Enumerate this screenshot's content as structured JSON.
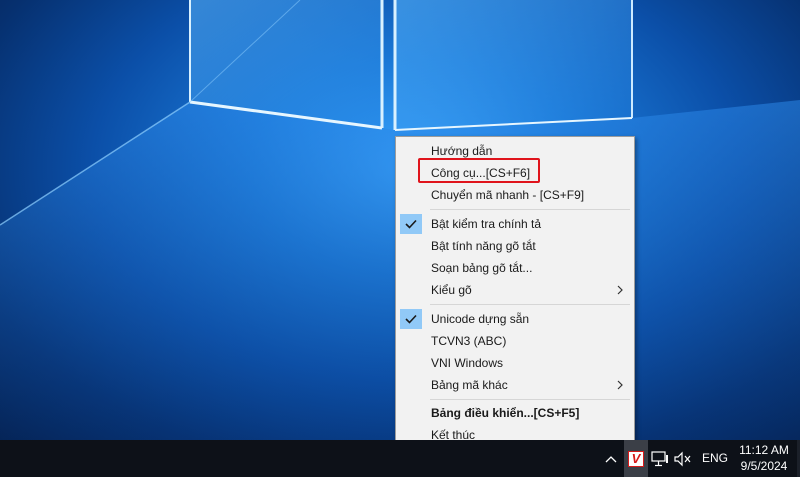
{
  "colors": {
    "menu_background": "#f2f2f2",
    "check_highlight": "#91c9f7",
    "annotation_red": "#e0141c",
    "taskbar": "#0d1118"
  },
  "menu": {
    "items": [
      {
        "label": "Hướng dẫn",
        "checked": false,
        "submenu": false,
        "bold": false
      },
      {
        "label": "Công cụ...[CS+F6]",
        "checked": false,
        "submenu": false,
        "bold": false
      },
      {
        "label": "Chuyển mã nhanh - [CS+F9]",
        "checked": false,
        "submenu": false,
        "bold": false
      },
      {
        "label": "Bật kiểm tra chính tả",
        "checked": true,
        "submenu": false,
        "bold": false
      },
      {
        "label": "Bật tính năng gõ tắt",
        "checked": false,
        "submenu": false,
        "bold": false
      },
      {
        "label": "Soạn bảng gõ tắt...",
        "checked": false,
        "submenu": false,
        "bold": false
      },
      {
        "label": "Kiểu gõ",
        "checked": false,
        "submenu": true,
        "bold": false
      },
      {
        "label": "Unicode dựng sẵn",
        "checked": true,
        "submenu": false,
        "bold": false
      },
      {
        "label": "TCVN3 (ABC)",
        "checked": false,
        "submenu": false,
        "bold": false
      },
      {
        "label": "VNI Windows",
        "checked": false,
        "submenu": false,
        "bold": false
      },
      {
        "label": "Bảng mã khác",
        "checked": false,
        "submenu": true,
        "bold": false
      },
      {
        "label": "Bảng điều khiển...[CS+F5]",
        "checked": false,
        "submenu": false,
        "bold": true
      },
      {
        "label": "Kết thúc",
        "checked": false,
        "submenu": false,
        "bold": false
      }
    ],
    "highlighted_item": "Công cụ...[CS+F6]"
  },
  "taskbar": {
    "tray_icons": [
      "chevron-up-icon",
      "unikey-v-icon",
      "network-icon",
      "volume-muted-icon"
    ],
    "app_icon_letter": "V",
    "language": "ENG",
    "time": "11:12 AM",
    "date": "9/5/2024"
  }
}
